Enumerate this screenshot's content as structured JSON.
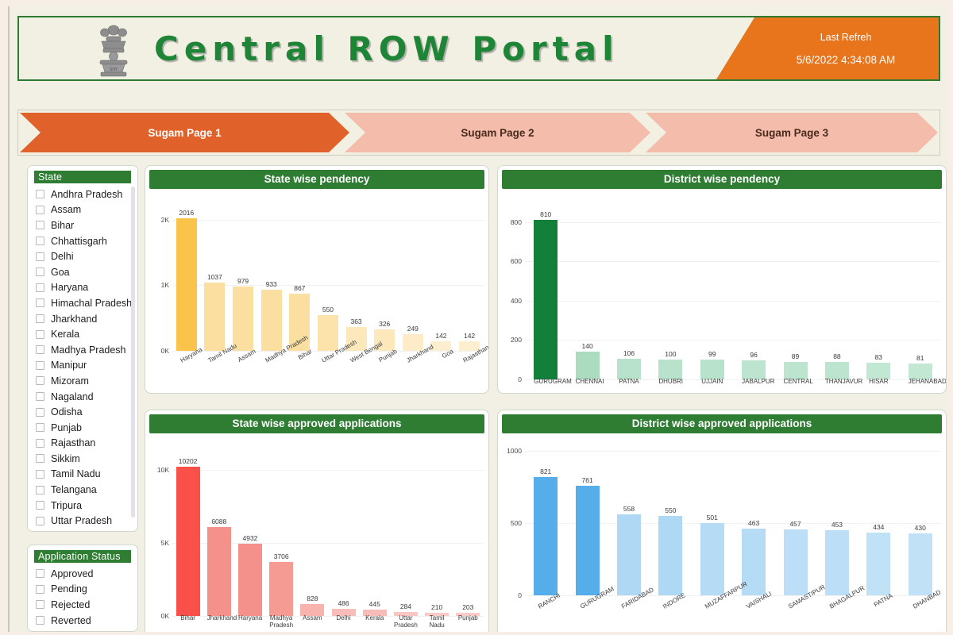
{
  "header": {
    "emblem_icon": "india-national-emblem-icon",
    "title": "Central ROW Portal",
    "refresh_label": "Last Refreh",
    "refresh_time": "5/6/2022 4:34:08 AM",
    "accent_orange": "#e8741c",
    "accent_green": "#1e8537"
  },
  "tabs": [
    {
      "label": "Sugam Page 1",
      "active": true
    },
    {
      "label": "Sugam Page 2",
      "active": false
    },
    {
      "label": "Sugam Page 3",
      "active": false
    }
  ],
  "filters": {
    "state": {
      "title": "State",
      "items": [
        "Andhra Pradesh",
        "Assam",
        "Bihar",
        "Chhattisgarh",
        "Delhi",
        "Goa",
        "Haryana",
        "Himachal Pradesh",
        "Jharkhand",
        "Kerala",
        "Madhya Pradesh",
        "Manipur",
        "Mizoram",
        "Nagaland",
        "Odisha",
        "Punjab",
        "Rajasthan",
        "Sikkim",
        "Tamil Nadu",
        "Telangana",
        "Tripura",
        "Uttar Pradesh"
      ]
    },
    "status": {
      "title": "Application Status",
      "items": [
        "Approved",
        "Pending",
        "Rejected",
        "Reverted"
      ]
    }
  },
  "chart_data": [
    {
      "id": "state-wise-pendency",
      "type": "bar",
      "title": "State wise pendency",
      "xlabel": "",
      "ylabel": "",
      "ylim": [
        0,
        2200
      ],
      "ytick_values": [
        0,
        1000,
        2000
      ],
      "ytick_labels": [
        "0K",
        "1K",
        "2K"
      ],
      "grid": true,
      "label_rotation": -30,
      "categories": [
        "Haryana",
        "Tamil Nadu",
        "Assam",
        "Madhya Pradesh",
        "Bihar",
        "Uttar Pradesh",
        "West Bengal",
        "Punjab",
        "Jharkhand",
        "Goa",
        "Rajasthan"
      ],
      "values": [
        2016,
        1037,
        979,
        933,
        867,
        550,
        363,
        326,
        249,
        142,
        142
      ],
      "colors": [
        "#fac44b",
        "#fbdfa0",
        "#fbdfa0",
        "#fbdfa0",
        "#fbdfa0",
        "#fce3ab",
        "#fce8bb",
        "#fce8bb",
        "#fdecc7",
        "#fdeed0",
        "#fdeed0"
      ]
    },
    {
      "id": "district-wise-pendency",
      "type": "bar",
      "title": "District wise pendency",
      "xlabel": "",
      "ylabel": "",
      "ylim": [
        0,
        880
      ],
      "ytick_values": [
        0,
        200,
        400,
        600,
        800
      ],
      "ytick_labels": [
        "0",
        "200",
        "400",
        "600",
        "800"
      ],
      "grid": true,
      "label_rotation": 0,
      "categories": [
        "GURUGRAM",
        "CHENNAI",
        "PATNA",
        "DHUBRI",
        "UJJAIN",
        "JABALPUR",
        "CENTRAL",
        "THANJAVUR",
        "HISAR",
        "JEHANABAD"
      ],
      "values": [
        810,
        140,
        106,
        100,
        99,
        96,
        89,
        88,
        83,
        81
      ],
      "colors": [
        "#128039",
        "#abdcc0",
        "#b8e2cb",
        "#b8e2cb",
        "#b8e2cb",
        "#bce4ce",
        "#bce4ce",
        "#bce4ce",
        "#c2e7d3",
        "#c2e7d3"
      ]
    },
    {
      "id": "state-wise-approved-applications",
      "type": "bar",
      "title": "State wise approved applications",
      "xlabel": "",
      "ylabel": "",
      "ylim": [
        0,
        11300
      ],
      "ytick_values": [
        0,
        5000,
        10000
      ],
      "ytick_labels": [
        "0K",
        "5K",
        "10K"
      ],
      "grid": true,
      "label_rotation": 0,
      "categories": [
        "Bihar",
        "Jharkhand",
        "Haryana",
        "Madhya\nPradesh",
        "Assam",
        "Delhi",
        "Kerala",
        "Uttar\nPradesh",
        "Tamil\nNadu",
        "Punjab"
      ],
      "values": [
        10202,
        6088,
        4932,
        3706,
        828,
        486,
        445,
        284,
        210,
        203
      ],
      "colors": [
        "#f9504a",
        "#f4918a",
        "#f4918a",
        "#f69a94",
        "#f8b3ae",
        "#f9bdb9",
        "#f9bdb9",
        "#fac6c2",
        "#fbcbc7",
        "#fbcbc7"
      ]
    },
    {
      "id": "district-wise-approved-applications",
      "type": "bar",
      "title": "District wise approved applications",
      "xlabel": "",
      "ylabel": "",
      "ylim": [
        0,
        1000
      ],
      "ytick_values": [
        0,
        500,
        1000
      ],
      "ytick_labels": [
        "0",
        "500",
        "1000"
      ],
      "grid": true,
      "label_rotation": -30,
      "categories": [
        "RANCHI",
        "GURUGRAM",
        "FARIDABAD",
        "INDORE",
        "MUZAFFARPUR",
        "VAISHALI",
        "SAMASTIPUR",
        "BHAGALPUR",
        "PATNA",
        "DHANBAD"
      ],
      "values": [
        821,
        761,
        558,
        550,
        501,
        463,
        457,
        453,
        434,
        430
      ],
      "colors": [
        "#55aeea",
        "#55aeea",
        "#afd8f4",
        "#afd8f4",
        "#b6dbf5",
        "#b6dbf5",
        "#bcdef6",
        "#bcdef6",
        "#c1e1f7",
        "#c1e1f7"
      ]
    }
  ]
}
